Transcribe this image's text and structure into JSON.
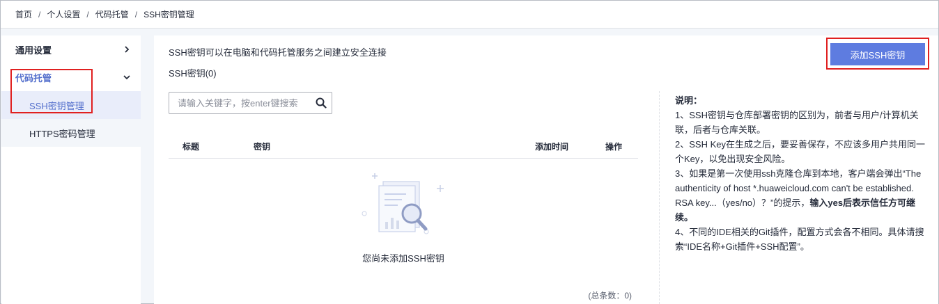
{
  "breadcrumb": {
    "items": [
      "首页",
      "个人设置",
      "代码托管",
      "SSH密钥管理"
    ],
    "separator": "/"
  },
  "sidebar": {
    "groups": [
      {
        "label": "通用设置",
        "icon": "chevron-right-icon"
      },
      {
        "label": "代码托管",
        "icon": "chevron-down-icon"
      }
    ],
    "items": [
      {
        "label": "SSH密钥管理"
      },
      {
        "label": "HTTPS密码管理"
      }
    ]
  },
  "main": {
    "intro": "SSH密钥可以在电脑和代码托管服务之间建立安全连接",
    "count": "SSH密钥(0)",
    "add_button": "添加SSH密钥",
    "search": {
      "placeholder": "请输入关键字，按enter键搜索",
      "value": "",
      "icon": "search-icon"
    },
    "table": {
      "columns": [
        "标题",
        "密钥",
        "添加时间",
        "操作"
      ],
      "rows": []
    },
    "empty_text": "您尚未添加SSH密钥",
    "total": "(总条数：0)"
  },
  "notes": {
    "title": "说明：",
    "item1": "1、SSH密钥与仓库部署密钥的区别为，前者与用户/计算机关联，后者与仓库关联。",
    "item2": "2、SSH Key在生成之后，要妥善保存，不应该多用户共用同一个Key，以免出现安全风险。",
    "item3_prefix": "3、如果是第一次使用ssh克隆仓库到本地，客户端会弹出“The authenticity of host *.huaweicloud.com can't be established. RSA key...（yes/no）？”的提示，",
    "item3_bold": "输入yes后表示信任方可继续。",
    "item4": "4、不同的IDE相关的Git插件，配置方式会各不相同。具体请搜索“IDE名称+Git插件+SSH配置”。"
  },
  "colors": {
    "accent": "#5e7ce0",
    "active_text": "#526ecc",
    "active_bg": "#e9edfa",
    "highlight_box": "#e02020"
  }
}
